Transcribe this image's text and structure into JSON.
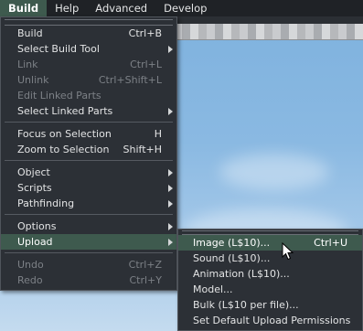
{
  "menubar": {
    "items": [
      {
        "label": "Build",
        "active": true
      },
      {
        "label": "Help"
      },
      {
        "label": "Advanced"
      },
      {
        "label": "Develop"
      }
    ]
  },
  "build_menu": {
    "group1": [
      {
        "label": "Build",
        "shortcut": "Ctrl+B"
      },
      {
        "label": "Select Build Tool",
        "submenu": true
      },
      {
        "label": "Link",
        "shortcut": "Ctrl+L",
        "disabled": true
      },
      {
        "label": "Unlink",
        "shortcut": "Ctrl+Shift+L",
        "disabled": true
      },
      {
        "label": "Edit Linked Parts",
        "disabled": true
      },
      {
        "label": "Select Linked Parts",
        "submenu": true
      }
    ],
    "group2": [
      {
        "label": "Focus on Selection",
        "shortcut": "H"
      },
      {
        "label": "Zoom to Selection",
        "shortcut": "Shift+H"
      }
    ],
    "group3": [
      {
        "label": "Object",
        "submenu": true
      },
      {
        "label": "Scripts",
        "submenu": true
      },
      {
        "label": "Pathfinding",
        "submenu": true
      }
    ],
    "group4": [
      {
        "label": "Options",
        "submenu": true
      },
      {
        "label": "Upload",
        "submenu": true,
        "highlighted": true
      }
    ],
    "group5": [
      {
        "label": "Undo",
        "shortcut": "Ctrl+Z",
        "disabled": true
      },
      {
        "label": "Redo",
        "shortcut": "Ctrl+Y",
        "disabled": true
      }
    ]
  },
  "upload_submenu": {
    "items": [
      {
        "label": "Image (L$10)...",
        "shortcut": "Ctrl+U",
        "highlighted": true
      },
      {
        "label": "Sound (L$10)..."
      },
      {
        "label": "Animation (L$10)..."
      },
      {
        "label": "Model..."
      },
      {
        "label": "Bulk (L$10 per file)..."
      },
      {
        "label": "Set Default Upload Permissions"
      }
    ]
  },
  "colors": {
    "menu_bg": "#2c3036",
    "highlight": "#3e5a4e",
    "text": "#e3e4e5",
    "disabled_text": "#7c8086"
  },
  "icons": [
    "submenu-arrow-icon",
    "mouse-pointer-icon"
  ]
}
